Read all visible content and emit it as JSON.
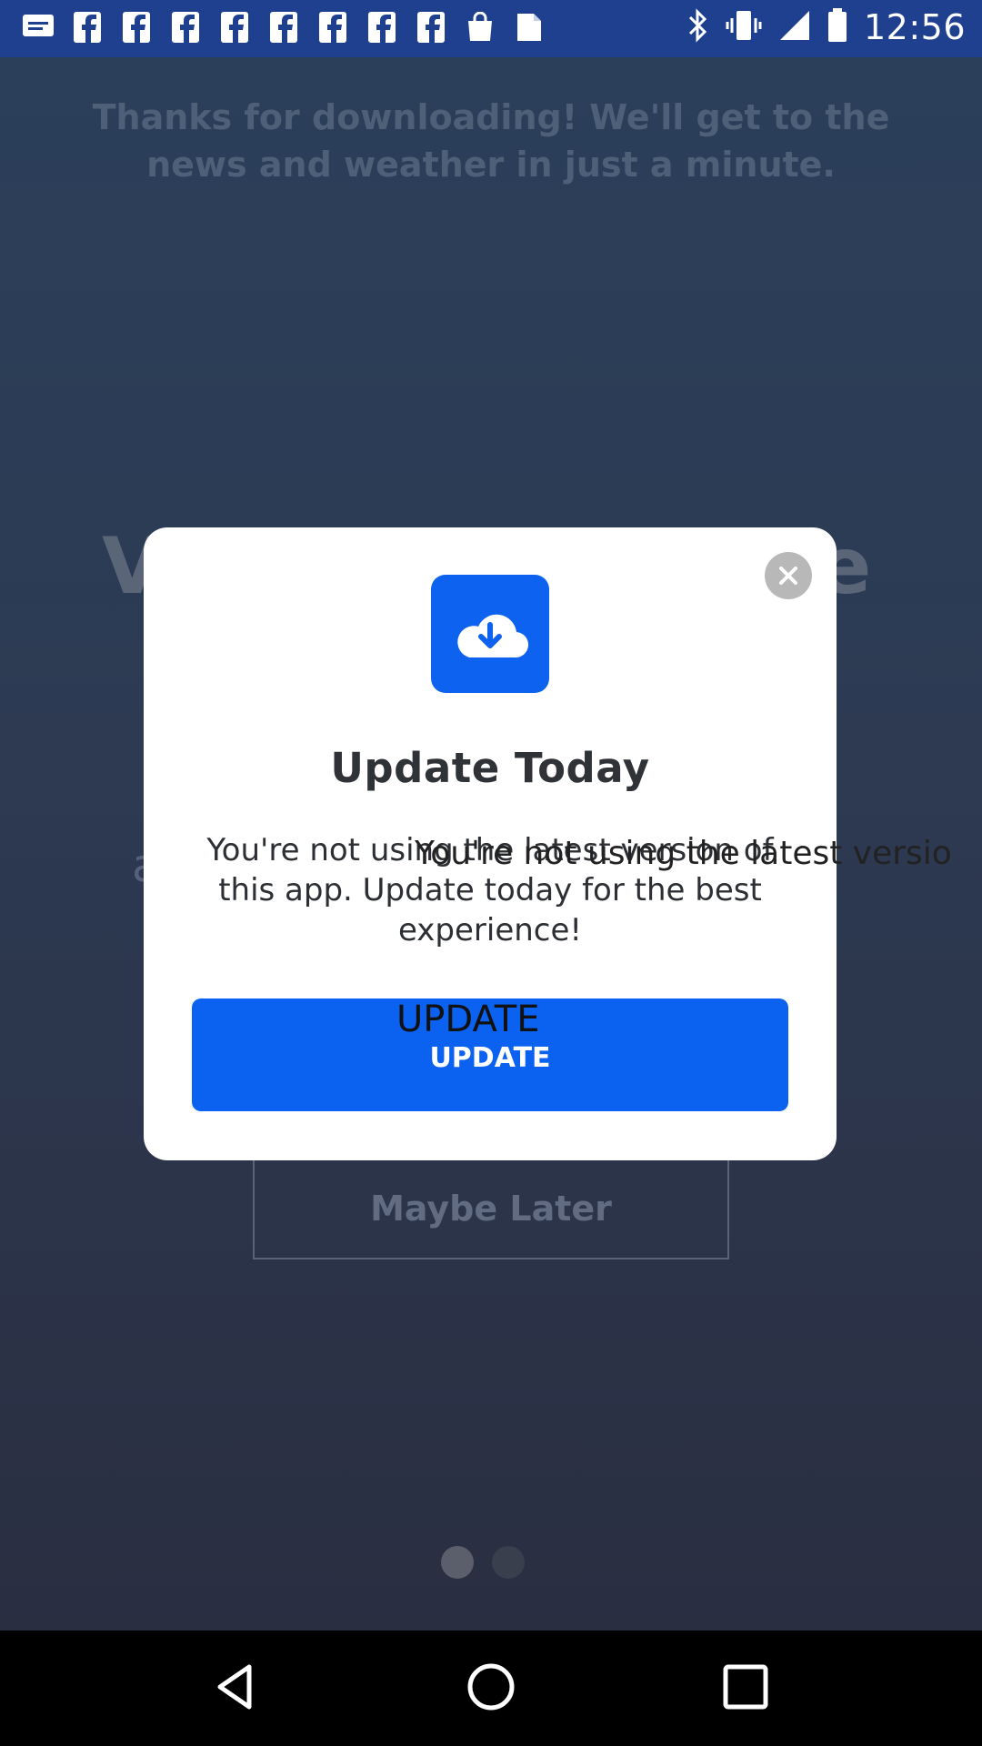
{
  "status_bar": {
    "time": "12:56",
    "icons_left": [
      "message-icon",
      "facebook-icon",
      "facebook-icon",
      "facebook-icon",
      "facebook-icon",
      "facebook-icon",
      "facebook-icon",
      "facebook-icon",
      "facebook-icon",
      "bag-icon",
      "document-icon"
    ],
    "icons_right": [
      "bluetooth-icon",
      "vibrate-icon",
      "signal-icon",
      "battery-icon"
    ]
  },
  "background": {
    "thanks_text": "Thanks for downloading! We'll get to the news and weather in just a minute.",
    "big_left": "V",
    "big_right": "e",
    "small_left": "a",
    "maybe_later": "Maybe Later",
    "page_indicator": {
      "current": 1,
      "total": 2
    }
  },
  "dialog": {
    "title": "Update Today",
    "body": "You're not using the latest version of this app. Update today for the best experience!",
    "overlay_text": "You're not using the latest versio",
    "button_label": "UPDATE",
    "button_overlay_label": "UPDATE",
    "accent_color": "#0b62f0"
  },
  "navbar": {
    "icons": [
      "back-icon",
      "home-icon",
      "recents-icon"
    ]
  }
}
